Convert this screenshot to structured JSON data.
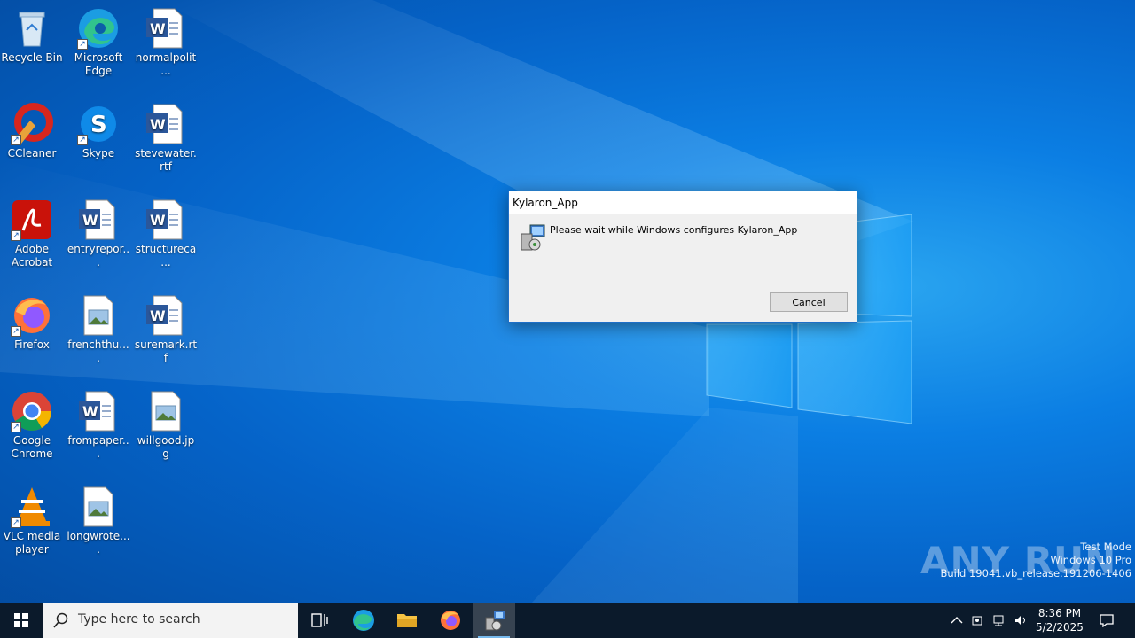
{
  "desktop": {
    "icons": [
      {
        "label": "Recycle Bin"
      },
      {
        "label": "Microsoft Edge"
      },
      {
        "label": "normalpolit..."
      },
      {
        "label": "CCleaner"
      },
      {
        "label": "Skype"
      },
      {
        "label": "stevewater.rtf"
      },
      {
        "label": "Adobe Acrobat"
      },
      {
        "label": "entryrepor..."
      },
      {
        "label": "structureca..."
      },
      {
        "label": "Firefox"
      },
      {
        "label": "frenchthu...."
      },
      {
        "label": "suremark.rtf"
      },
      {
        "label": "Google Chrome"
      },
      {
        "label": "frompaper..."
      },
      {
        "label": "willgood.jpg"
      },
      {
        "label": "VLC media player"
      },
      {
        "label": "longwrote...."
      }
    ]
  },
  "dialog": {
    "title": "Kylaron_App",
    "message": "Please wait while Windows configures Kylaron_App",
    "cancel_label": "Cancel"
  },
  "watermark": {
    "brand": "ANY RUN",
    "line1": "Test Mode",
    "line2": "Windows 10 Pro",
    "line3": "Build 19041.vb_release.191206-1406"
  },
  "taskbar": {
    "search_placeholder": "Type here to search",
    "time": "8:36 PM",
    "date": "5/2/2025"
  },
  "colors": {
    "accent": "#0b7ee3",
    "taskbar": "#0b1a2b",
    "dialog_border": "#1e6fc8"
  }
}
